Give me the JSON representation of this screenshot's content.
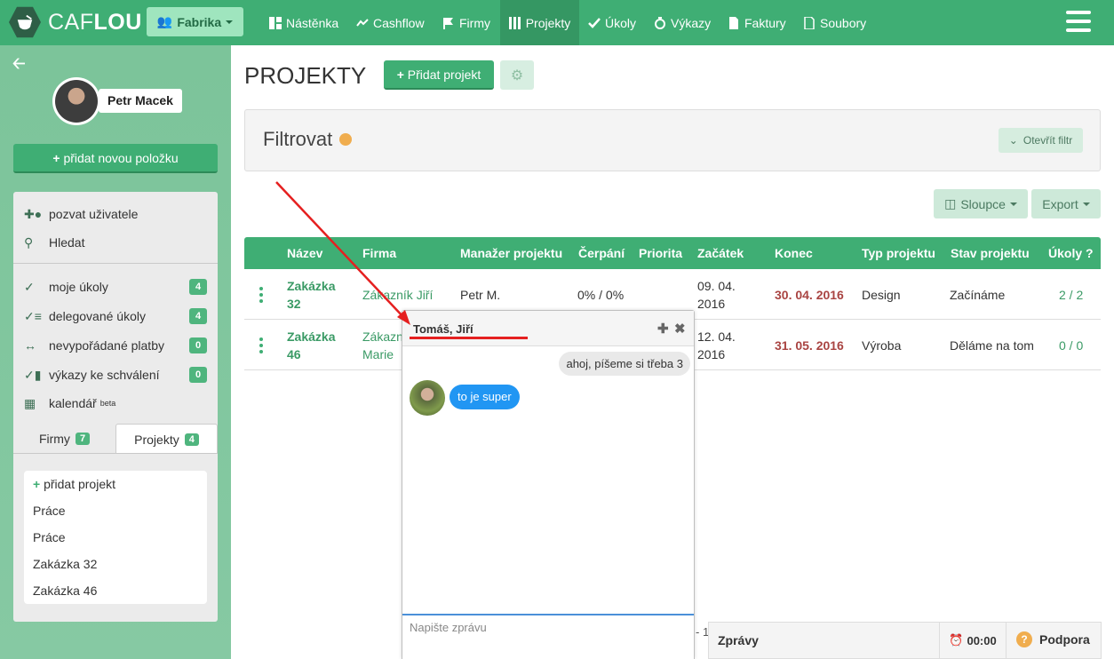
{
  "brand": {
    "part1": "CAF",
    "part2": "LOU"
  },
  "org_button": {
    "label": "Fabrika"
  },
  "nav": [
    {
      "label": "Nástěnka",
      "icon": "dashboard-icon"
    },
    {
      "label": "Cashflow",
      "icon": "chart-line-icon"
    },
    {
      "label": "Firmy",
      "icon": "flag-icon"
    },
    {
      "label": "Projekty",
      "icon": "columns-icon",
      "active": true
    },
    {
      "label": "Úkoly",
      "icon": "check-icon"
    },
    {
      "label": "Výkazy",
      "icon": "stopwatch-icon"
    },
    {
      "label": "Faktury",
      "icon": "invoice-icon"
    },
    {
      "label": "Soubory",
      "icon": "file-icon"
    }
  ],
  "sidebar": {
    "user_name": "Petr Macek",
    "add_item_label": "přidat novou položku",
    "menu": [
      {
        "label": "pozvat uživatele",
        "icon": "user-plus-icon"
      },
      {
        "label": "Hledat",
        "icon": "search-icon"
      }
    ],
    "tasks": [
      {
        "label": "moje úkoly",
        "badge": "4",
        "icon": "my-tasks-icon"
      },
      {
        "label": "delegované úkoly",
        "badge": "4",
        "icon": "delegated-tasks-icon"
      },
      {
        "label": "nevypořádané platby",
        "badge": "0",
        "icon": "exchange-icon"
      },
      {
        "label": "výkazy ke schválení",
        "badge": "0",
        "icon": "reports-icon"
      },
      {
        "label": "kalendář",
        "beta": "beta",
        "icon": "calendar-icon"
      }
    ],
    "tabs": [
      {
        "label": "Firmy",
        "badge": "7"
      },
      {
        "label": "Projekty",
        "badge": "4"
      }
    ],
    "project_list": {
      "add_label": "přidat projekt",
      "items": [
        "Práce",
        "Práce",
        "Zakázka 32",
        "Zakázka 46"
      ]
    }
  },
  "main": {
    "title": "PROJEKTY",
    "add_project_label": "Přidat projekt",
    "filter_title": "Filtrovat",
    "open_filter_label": "Otevřít filtr",
    "columns_label": "Sloupce",
    "export_label": "Export"
  },
  "table": {
    "headers": [
      "Název",
      "Firma",
      "Manažer projektu",
      "Čerpání",
      "Priorita",
      "Začátek",
      "Konec",
      "Typ projektu",
      "Stav projektu",
      "Úkoly ?"
    ],
    "rows": [
      {
        "name1": "Zakázka",
        "name2": "32",
        "firm1": "Zákazník Jiří",
        "firm2": "",
        "manager": "Petr M.",
        "spend": "0% / 0%",
        "priority": "",
        "start1": "09. 04.",
        "start2": "2016",
        "end": "30. 04. 2016",
        "type": "Design",
        "status": "Začínáme",
        "tasks": "2 / 2"
      },
      {
        "name1": "Zakázka",
        "name2": "46",
        "firm1": "Zákazn",
        "firm2": "Marie",
        "manager": "",
        "spend": "",
        "priority": "",
        "start1": "12. 04.",
        "start2": "2016",
        "end": "31. 05. 2016",
        "type": "Výroba",
        "status": "Děláme na tom",
        "tasks": "0 / 0"
      }
    ],
    "pager_fragment": "- 1"
  },
  "chat": {
    "title": "Tomáš, Jiří",
    "messages": [
      {
        "direction": "out",
        "text": "ahoj, píšeme si třeba 3"
      },
      {
        "direction": "in",
        "text": "to je super"
      }
    ],
    "input_placeholder": "Napište zprávu"
  },
  "bottom_bar": {
    "messages_label": "Zprávy",
    "timer": "00:00",
    "support_label": "Podpora"
  },
  "colors": {
    "primary": "#3fae74",
    "sidebar": "#7cc49a",
    "accent_red": "#e52020",
    "chat_bubble": "#2196f3"
  }
}
